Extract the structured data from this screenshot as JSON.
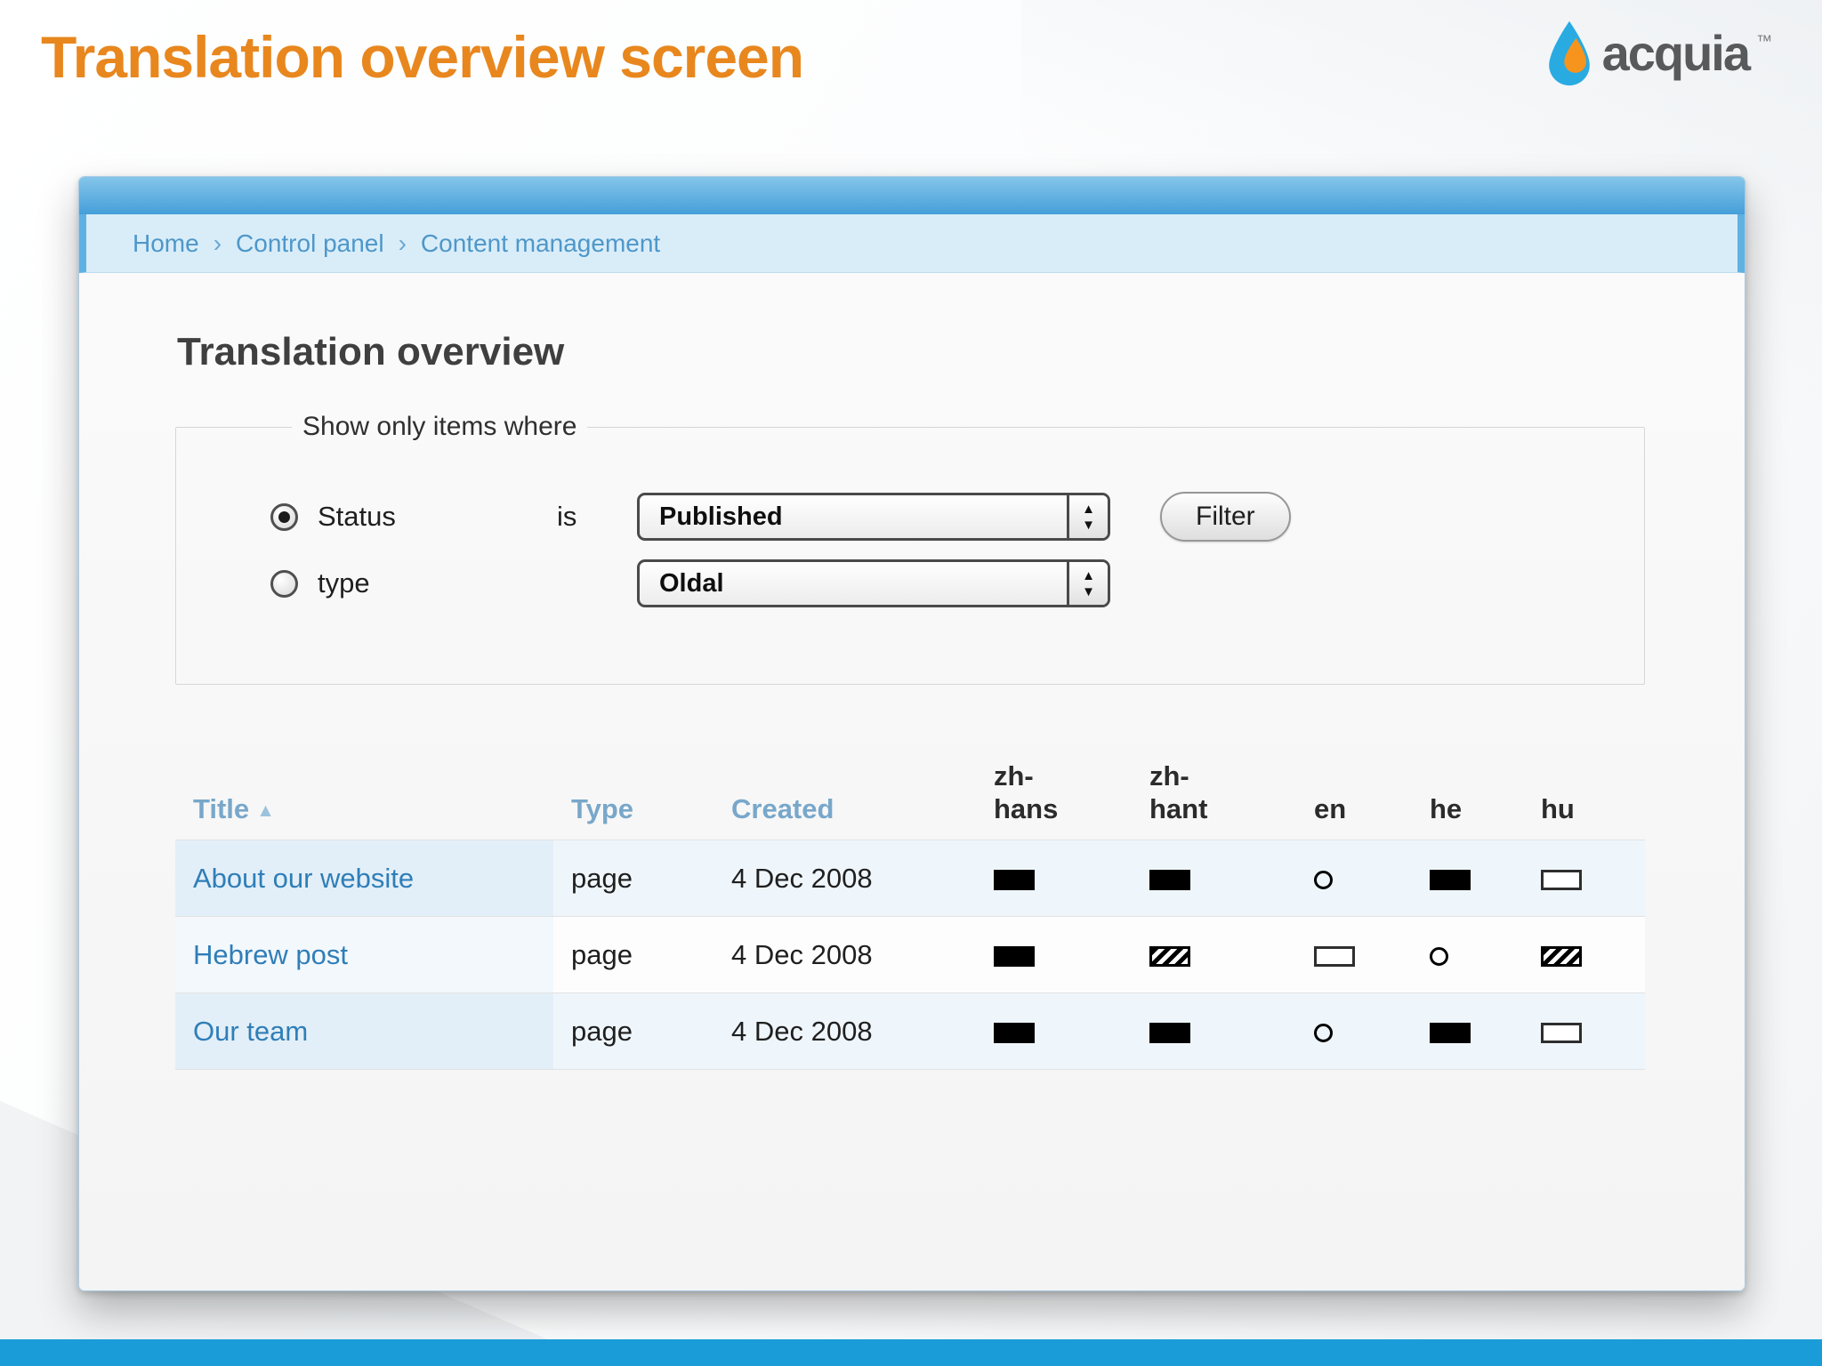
{
  "slide": {
    "title": "Translation overview screen",
    "logo_text": "acquia",
    "logo_tm": "™"
  },
  "breadcrumb": {
    "separator": "›",
    "items": [
      "Home",
      "Control panel",
      "Content management"
    ]
  },
  "content": {
    "page_title": "Translation overview"
  },
  "filter": {
    "legend": "Show only items where",
    "status": {
      "label": "Status",
      "selected": true,
      "connector": "is",
      "value": "Published"
    },
    "type": {
      "label": "type",
      "selected": false,
      "value": "Oldal"
    },
    "button_label": "Filter"
  },
  "table": {
    "sort_direction": "asc",
    "columns": {
      "title": "Title",
      "type": "Type",
      "created": "Created",
      "languages": [
        "zh-hans",
        "zh-hant",
        "en",
        "he",
        "hu"
      ]
    },
    "rows": [
      {
        "title": "About our website",
        "type": "page",
        "created": "4 Dec 2008",
        "statuses": [
          "published",
          "published",
          "original",
          "published",
          "untranslated"
        ]
      },
      {
        "title": "Hebrew post",
        "type": "page",
        "created": "4 Dec 2008",
        "statuses": [
          "published",
          "outofdate",
          "untranslated",
          "original",
          "outofdate"
        ]
      },
      {
        "title": "Our team",
        "type": "page",
        "created": "4 Dec 2008",
        "statuses": [
          "published",
          "published",
          "original",
          "published",
          "untranslated"
        ]
      }
    ]
  },
  "colors": {
    "title_orange": "#E8871E",
    "bottom_bar_blue": "#1A9CD8",
    "link_blue": "#2F7EB8",
    "breadcrumb_blue": "#4E97C9",
    "status_black": "#000000"
  }
}
